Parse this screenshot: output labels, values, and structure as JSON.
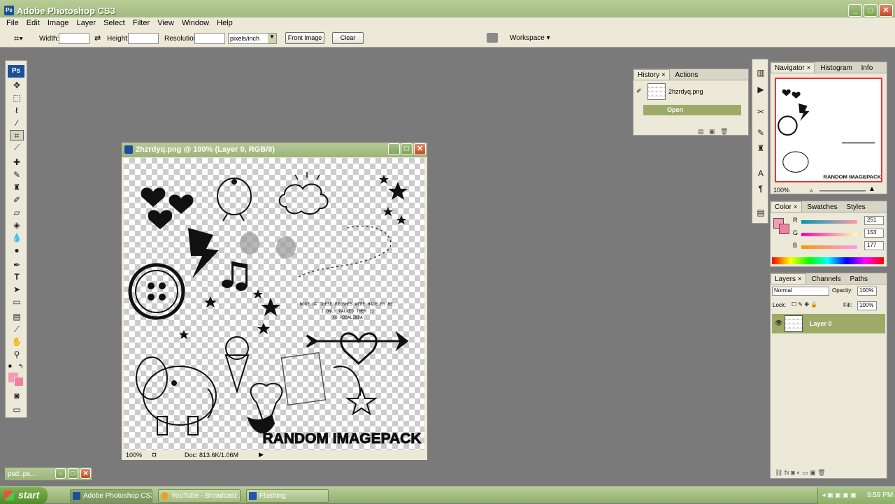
{
  "window": {
    "title": "Adobe Photoshop CS3"
  },
  "menu": [
    "File",
    "Edit",
    "Image",
    "Layer",
    "Select",
    "Filter",
    "View",
    "Window",
    "Help"
  ],
  "options": {
    "width_label": "Width:",
    "height_label": "Height:",
    "resolution_label": "Resolution:",
    "units_value": "pixels/inch",
    "front_image_label": "Front Image",
    "clear_label": "Clear",
    "workspace_label": "Workspace"
  },
  "toolbox": {
    "logo": "Ps"
  },
  "document": {
    "title": "2hzrdyq.png @ 100% (Layer 0, RGB/8)",
    "zoom": "100%",
    "doc_info": "Doc: 813.6K/1.06M",
    "canvas_text": [
      "NONE OF THESE BRUSHES WERE MADE BY ME.",
      "I ONLY PACKED THEM :)",
      "XO    ROSALINDA"
    ],
    "banner": "RANDOM IMAGEPACK"
  },
  "history": {
    "tabs": [
      "History",
      "Actions"
    ],
    "snapshot": "2hzrdyq.png",
    "state": "Open"
  },
  "navigator": {
    "tabs": [
      "Navigator",
      "Histogram",
      "Info"
    ],
    "zoom": "100%"
  },
  "color": {
    "tabs": [
      "Color",
      "Swatches",
      "Styles"
    ],
    "r_label": "R",
    "g_label": "G",
    "b_label": "B",
    "r": "251",
    "g": "153",
    "b": "177",
    "fg_color": "#fb99b1"
  },
  "layers": {
    "tabs": [
      "Layers",
      "Channels",
      "Paths"
    ],
    "blend_mode": "Normal",
    "opacity_label": "Opacity:",
    "opacity": "100%",
    "lock_label": "Lock:",
    "fill_label": "Fill:",
    "fill": "100%",
    "layer_name": "Layer 0"
  },
  "minimized_doc": {
    "title": "psd..ps..."
  },
  "taskbar": {
    "start": "start",
    "tasks": [
      "Adobe Photoshop CS3",
      "YouTube - Broadcast ...",
      "Flashing"
    ],
    "clock": "9:59 PM"
  }
}
